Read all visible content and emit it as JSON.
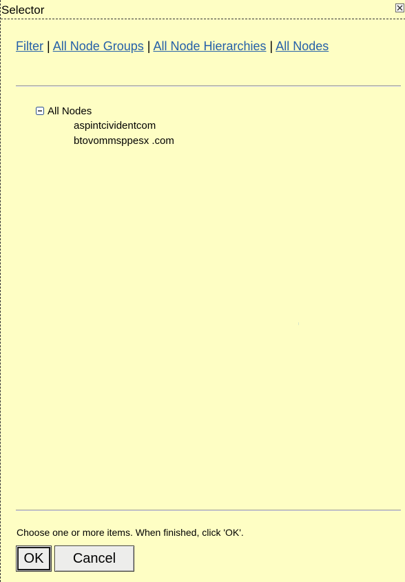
{
  "window": {
    "title": "Selector"
  },
  "links": {
    "filter": "Filter",
    "all_node_groups": "All Node Groups",
    "all_node_hierarchies": "All Node Hierarchies",
    "all_nodes": "All Nodes",
    "separator": " | "
  },
  "tree": {
    "root_label": "All Nodes",
    "root_expanded": true,
    "children": [
      "aspintcividentcom",
      "btovommsppesx .com"
    ]
  },
  "footer": {
    "instruction": "Choose one or more items. When finished, click 'OK'.",
    "ok_label": "OK",
    "cancel_label": "Cancel"
  },
  "icons": {
    "close": "close-icon",
    "collapse": "minus-box-icon"
  },
  "colors": {
    "panel_background": "#fefec4",
    "link": "#2560a8",
    "button_face": "#ededeb"
  }
}
